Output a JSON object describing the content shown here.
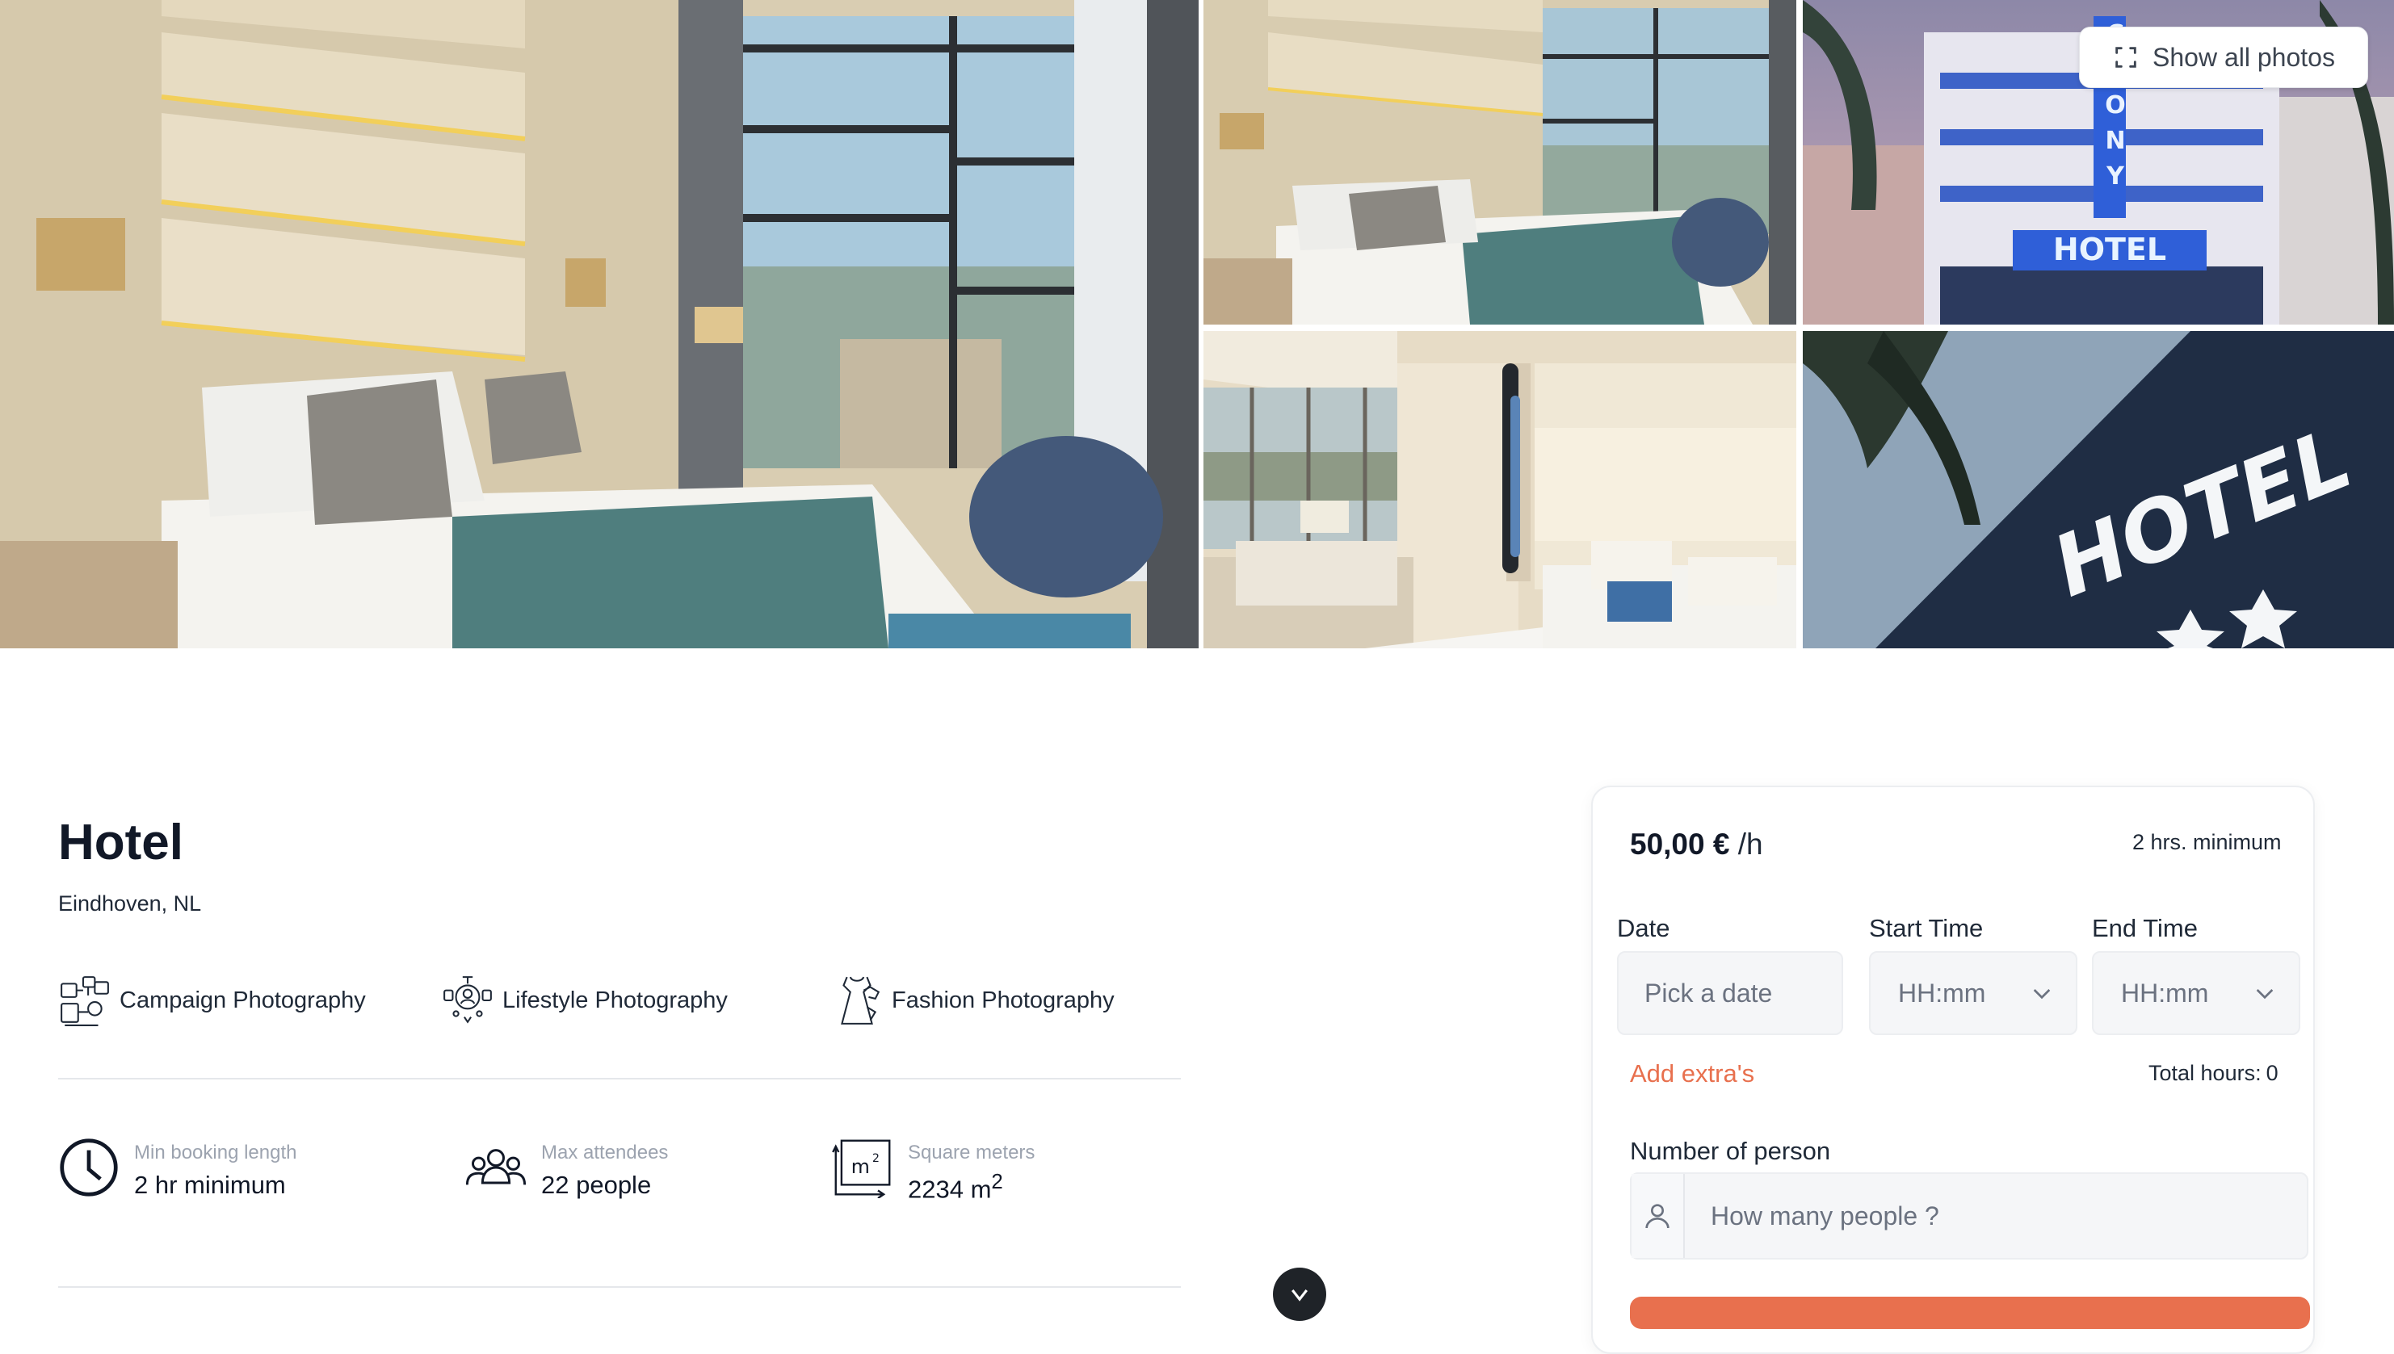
{
  "gallery": {
    "show_all_label": "Show all photos",
    "photos": [
      {
        "name": "hotel-room-main"
      },
      {
        "name": "hotel-room-side"
      },
      {
        "name": "hotel-exterior-colony"
      },
      {
        "name": "hotel-suite-view"
      },
      {
        "name": "hotel-sign-night"
      }
    ],
    "sign_text": "HOTEL",
    "colony_letters": [
      "C",
      "L",
      "O",
      "N",
      "Y"
    ]
  },
  "listing": {
    "title": "Hotel",
    "location": "Eindhoven, NL",
    "categories": [
      {
        "label": "Campaign Photography",
        "icon": "campaign-photography-icon"
      },
      {
        "label": "Lifestyle Photography",
        "icon": "lifestyle-photography-icon"
      },
      {
        "label": "Fashion Photography",
        "icon": "fashion-photography-icon"
      }
    ],
    "stats": [
      {
        "label": "Min booking length",
        "value": "2 hr minimum",
        "icon": "clock-icon"
      },
      {
        "label": "Max attendees",
        "value": "22 people",
        "icon": "people-icon"
      },
      {
        "label": "Square meters",
        "value": "2234 m",
        "unit_sup": "2",
        "icon": "square-meters-icon"
      }
    ]
  },
  "booking": {
    "price": "50,00 €",
    "price_unit": "/h",
    "minimum": "2 hrs. minimum",
    "date_label": "Date",
    "date_placeholder": "Pick a date",
    "start_label": "Start Time",
    "start_placeholder": "HH:mm",
    "end_label": "End Time",
    "end_placeholder": "HH:mm",
    "extras_label": "Add extra's",
    "total_label": "Total hours:",
    "total_value": "0",
    "people_label": "Number of person",
    "people_placeholder": "How many people ?"
  },
  "colors": {
    "accent": "#e8704e",
    "text": "#111827",
    "muted": "#9ca3af",
    "field_bg": "#f5f6f8"
  }
}
